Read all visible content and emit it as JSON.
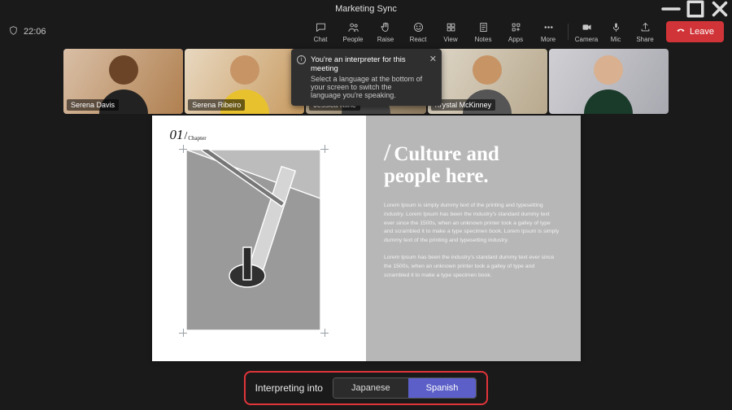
{
  "window": {
    "title": "Marketing Sync"
  },
  "status": {
    "time": "22:06"
  },
  "toolbar": {
    "chat": "Chat",
    "people": "People",
    "raise": "Raise",
    "react": "React",
    "view": "View",
    "notes": "Notes",
    "apps": "Apps",
    "more": "More",
    "camera": "Camera",
    "mic": "Mic",
    "share": "Share",
    "leave": "Leave"
  },
  "participants": [
    {
      "name": "Serena Davis"
    },
    {
      "name": "Serena Ribeiro"
    },
    {
      "name": "Jessica Kline"
    },
    {
      "name": "Krystal McKinney"
    },
    {
      "name": ""
    }
  ],
  "toast": {
    "title": "You're an interpreter for this meeting",
    "body": "Select a language at the bottom of your screen to switch the language you're speaking."
  },
  "slide": {
    "chapter_num": "01",
    "chapter_label": "Chapter",
    "heading": "Culture and people here.",
    "para1": "Lorem Ipsum is simply dummy text of the printing and typesetting industry. Lorem Ipsum has been the industry's standard dummy text ever since the 1500s, when an unknown printer took a galley of type and scrambled it to make a type specimen book. Lorem Ipsum is simply dummy text of the printing and typesetting industry.",
    "para2": "Lorem Ipsum has been the industry's standard dummy text ever since the 1500s, when an unknown printer took a galley of type and scrambled it to make a type specimen book."
  },
  "interpreter": {
    "label": "Interpreting into",
    "options": [
      "Japanese",
      "Spanish"
    ],
    "selected": "Spanish"
  },
  "colors": {
    "accent": "#5b5fc7",
    "danger": "#d13438",
    "highlight": "#e0353a"
  }
}
